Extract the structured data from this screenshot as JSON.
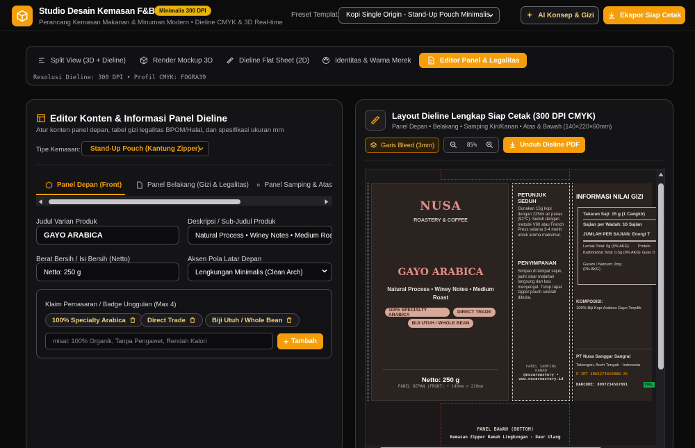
{
  "header": {
    "app_title": "Studio Desain Kemasan F&B",
    "badge": "Minimalis 300 DPI",
    "subtitle": "Perancang Kemasan Makanan & Minuman Modern • Dieline CMYK & 3D Real-time",
    "preset_label": "Preset Templat:",
    "preset_value": "Kopi Single Origin - Stand-Up Pouch Minimalis",
    "ai_button": "AI Konsep & Gizi",
    "export_button": "Ekspor Siap Cetak"
  },
  "tabs": [
    {
      "label": "Split View (3D + Dieline)",
      "icon": "columns-icon"
    },
    {
      "label": "Render Mockup 3D",
      "icon": "cube-icon"
    },
    {
      "label": "Dieline Flat Sheet (2D)",
      "icon": "ruler-icon"
    },
    {
      "label": "Identitas & Warna Merek",
      "icon": "palette-icon"
    },
    {
      "label": "Editor Panel & Legalitas",
      "icon": "document-icon"
    }
  ],
  "resolution_info": "Resolusi Dieline: 300 DPI • Profil CMYK: FOGRA39",
  "editor": {
    "title": "Editor Konten & Informasi Panel Dieline",
    "subtitle": "Atur konten panel depan, tabel gizi legalitas BPOM/Halal, dan spesifikasi ukuran mm",
    "kind_label": "Tipe Kemasan:",
    "kind_value": "Stand-Up Pouch (Kantung Zipper)",
    "subtabs": [
      "Panel Depan (Front)",
      "Panel Belakang (Gizi & Legalitas)",
      "Panel Samping & Atas"
    ],
    "fields": {
      "title_label": "Judul Varian Produk",
      "title_value": "GAYO ARABICA",
      "desc_label": "Deskripsi / Sub-Judul Produk",
      "desc_value": "Natural Process • Winey Notes • Medium Roast",
      "weight_label": "Berat Bersih / Isi Bersih (Netto)",
      "weight_value": "Netto: 250 g",
      "accent_label": "Aksen Pola Latar Depan",
      "accent_value": "Lengkungan Minimalis (Clean Arch)"
    },
    "claims": {
      "title": "Klaim Pemasaran / Badge Unggulan (Max 4)",
      "chips": [
        "100% Specialty Arabica",
        "Direct Trade",
        "Biji Utuh / Whole Bean"
      ],
      "placeholder": "misal: 100% Organik, Tanpa Pengawet, Rendah Kalori",
      "add_button": "Tambah"
    }
  },
  "dieline": {
    "title": "Layout Dieline Lengkap Siap Cetak (300 DPI CMYK)",
    "subtitle": "Panel Depan • Belakang • Samping Kiri/Kanan • Atas & Bawah (140×220×60mm)",
    "bleed_button": "Garis Bleed (3mm)",
    "zoom": "85%",
    "download_button": "Unduh Dieline PDF",
    "front": {
      "brand": "NUSA",
      "tagline": "ROASTERY & COFFEE",
      "variant": "GAYO ARABICA",
      "desc": "Natural Process • Winey Notes • Medium Roast",
      "badges": [
        "100% SPECIALTY ARABICA",
        "DIRECT TRADE",
        "BIJI UTUH / WHOLE BEAN"
      ],
      "netto": "Netto: 250 g",
      "caption": "PANEL DEPAN (FRONT) • 140mm × 220mm"
    },
    "side": {
      "h1": "PETUNJUK SEDUH",
      "t1": "Gunakan 15g kopi dengan 225ml air panas (92°C). Seduh dengan metode V60 atau French Press selama 3-4 menit untuk aroma maksimal.",
      "h2": "PENYIMPANAN",
      "t2": "Simpan di tempat sejuk, jauhi sinar matahari langsung dan bau menyengat. Tutup rapat zipper pouch setelah dibuka.",
      "caption1": "PANEL SAMPING",
      "caption2": "KANAN",
      "social": "@nusaroastery •",
      "website": "www.nusaroastery.id"
    },
    "back": {
      "title": "INFORMASI NILAI GIZI",
      "serving": "Takaran Saji: 15 g (1 Cangkir)",
      "per_pack": "Sajian per Wadah: 16 Sajian",
      "per_serving": "JUMLAH PER SAJIAN: Energi T",
      "fat": "Lemak Total: 0g (0% AKG)",
      "fat_right": "Protein",
      "carb": "Karbohidrat Total: 0.5g (0% AKG)",
      "carb_right": "Gula: 0",
      "salt": "Garam / Natrium: 2mg (0% AKG)",
      "comp_title": "KOMPOSISI:",
      "comp": "100% Biji Kopi Arabica Gayo Terpilih",
      "company": "PT Nusa Sanggar Sangrai",
      "address": "Takengon, Aceh Tengah - Indonesia",
      "pirt": "P-IRT 2063273010988-26",
      "barcode": "BARCODE: 8997234567891",
      "halal": "HAL"
    },
    "bottom": {
      "title": "PANEL BAWAH (BOTTOM)",
      "desc": "Kemasan Zipper Ramah Lingkungan - Daur Ulang"
    }
  }
}
